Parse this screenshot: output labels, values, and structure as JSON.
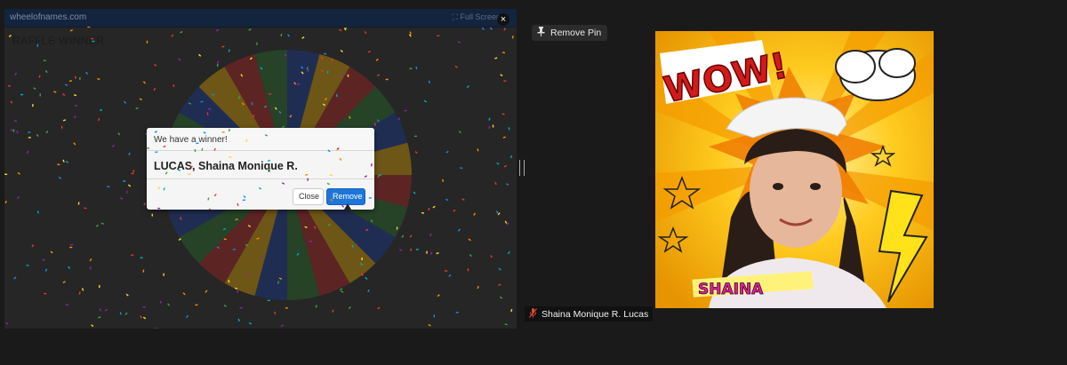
{
  "share": {
    "url": "wheelofnames.com",
    "fullscreen_label": "⛶ Full Screen",
    "close_glyph": "×",
    "heading": "RAFFLE WINNER"
  },
  "dialog": {
    "title": "We have a winner!",
    "winner": "LUCAS, Shaina Monique R.",
    "close_label": "Close",
    "remove_label": "Remove"
  },
  "pin": {
    "label": "Remove Pin",
    "icon": "pushpin-icon"
  },
  "video": {
    "wow_text": "WOW!",
    "sticker_text": "SHAINA"
  },
  "participant": {
    "name": "Shaina Monique R. Lucas",
    "mic_icon": "muted-mic-icon",
    "mic_color": "#e0443a"
  },
  "colors": {
    "wheel": [
      "#c62828",
      "#2e7d32",
      "#1e40a8",
      "#f6b200"
    ],
    "primary_button": "#1e75d8"
  }
}
